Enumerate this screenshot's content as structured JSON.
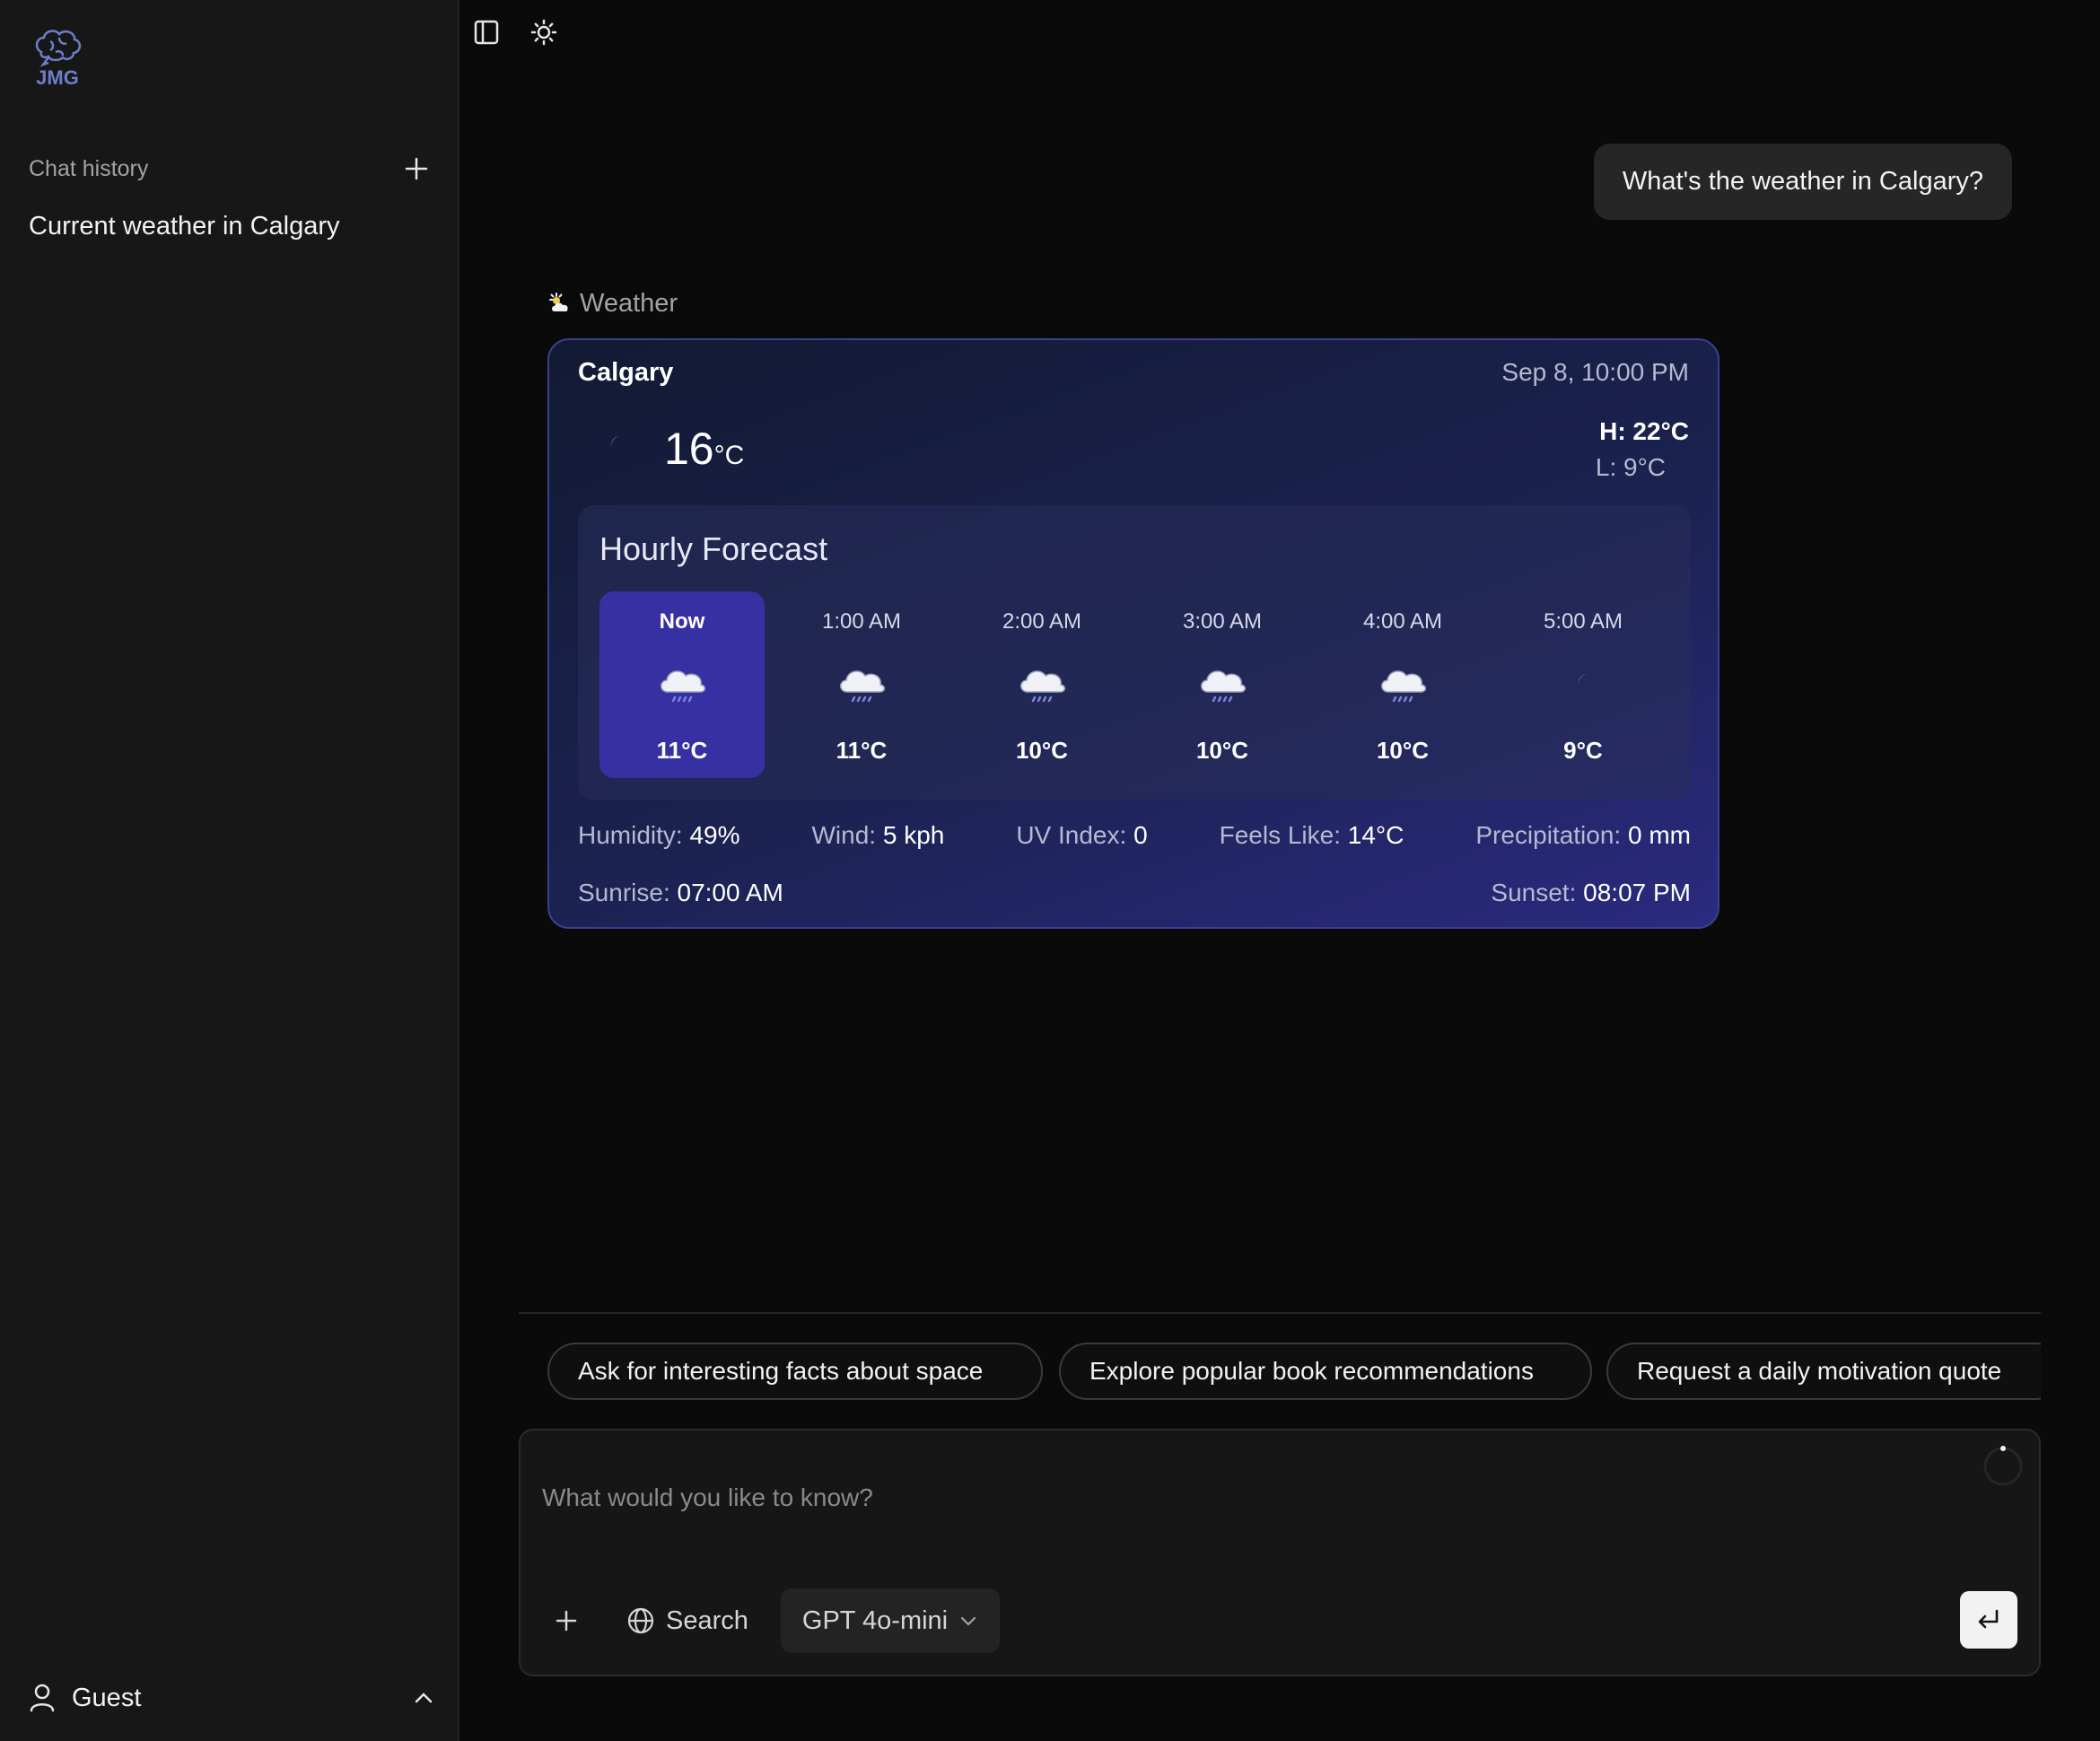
{
  "sidebar": {
    "logo_text": "JMG",
    "history_title": "Chat history",
    "history_items": [
      "Current weather in Calgary"
    ],
    "user_name": "Guest"
  },
  "chat": {
    "user_message": "What's the weather in Calgary?",
    "tool_label": "Weather"
  },
  "weather": {
    "city": "Calgary",
    "datetime": "Sep 8, 10:00 PM",
    "current_temp": "16",
    "unit": "°C",
    "high": "H: 22°C",
    "low": "L: 9°C",
    "hourly_title": "Hourly Forecast",
    "hourly": [
      {
        "time": "Now",
        "temp": "11°C",
        "icon": "rain-cloud-icon"
      },
      {
        "time": "1:00 AM",
        "temp": "11°C",
        "icon": "rain-cloud-icon"
      },
      {
        "time": "2:00 AM",
        "temp": "10°C",
        "icon": "rain-cloud-icon"
      },
      {
        "time": "3:00 AM",
        "temp": "10°C",
        "icon": "rain-cloud-icon"
      },
      {
        "time": "4:00 AM",
        "temp": "10°C",
        "icon": "rain-cloud-icon"
      },
      {
        "time": "5:00 AM",
        "temp": "9°C",
        "icon": "moon-icon"
      }
    ],
    "details": {
      "humidity_label": "Humidity:",
      "humidity": "49%",
      "wind_label": "Wind:",
      "wind": "5 kph",
      "uv_label": "UV Index:",
      "uv": "0",
      "feels_label": "Feels Like:",
      "feels": "14°C",
      "precip_label": "Precipitation:",
      "precip": "0 mm",
      "sunrise_label": "Sunrise:",
      "sunrise": "07:00 AM",
      "sunset_label": "Sunset:",
      "sunset": "08:07 PM"
    }
  },
  "suggestions": [
    "Ask for interesting facts about space",
    "Explore popular book recommendations",
    "Request a daily motivation quote"
  ],
  "composer": {
    "placeholder": "What would you like to know?",
    "search_label": "Search",
    "model": "GPT 4o-mini"
  },
  "colors": {
    "accent": "#3730a3",
    "logo": "#6b7fc9",
    "background": "#0a0a0a",
    "sidebar": "#171717"
  }
}
